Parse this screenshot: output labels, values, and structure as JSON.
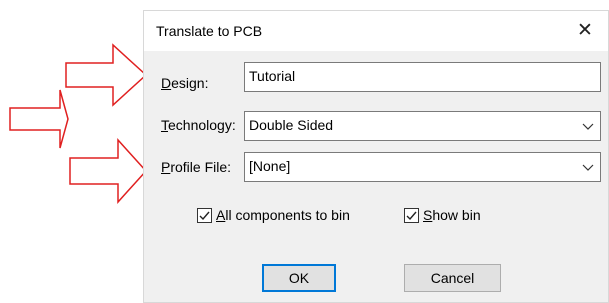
{
  "dialog": {
    "title": "Translate to PCB",
    "close_glyph": "✕"
  },
  "design": {
    "label_mnemonic": "D",
    "label_rest": "esign:",
    "value": "Tutorial"
  },
  "technology": {
    "label_mnemonic": "T",
    "label_rest": "echnology:",
    "value": "Double Sided",
    "icon": "chevron-down-icon"
  },
  "profile": {
    "label_mnemonic": "P",
    "label_rest": "rofile File:",
    "value": "[None]",
    "icon": "chevron-down-icon"
  },
  "options": {
    "all_components": {
      "mnemonic": "A",
      "rest": "ll components to bin",
      "checked": true
    },
    "show_bin": {
      "mnemonic": "S",
      "rest": "how bin",
      "checked": true
    }
  },
  "buttons": {
    "ok": "OK",
    "cancel": "Cancel"
  },
  "annotation": {
    "arrow_color": "#e02020",
    "arrow_count": 3,
    "icon": "right-arrow-icon"
  }
}
